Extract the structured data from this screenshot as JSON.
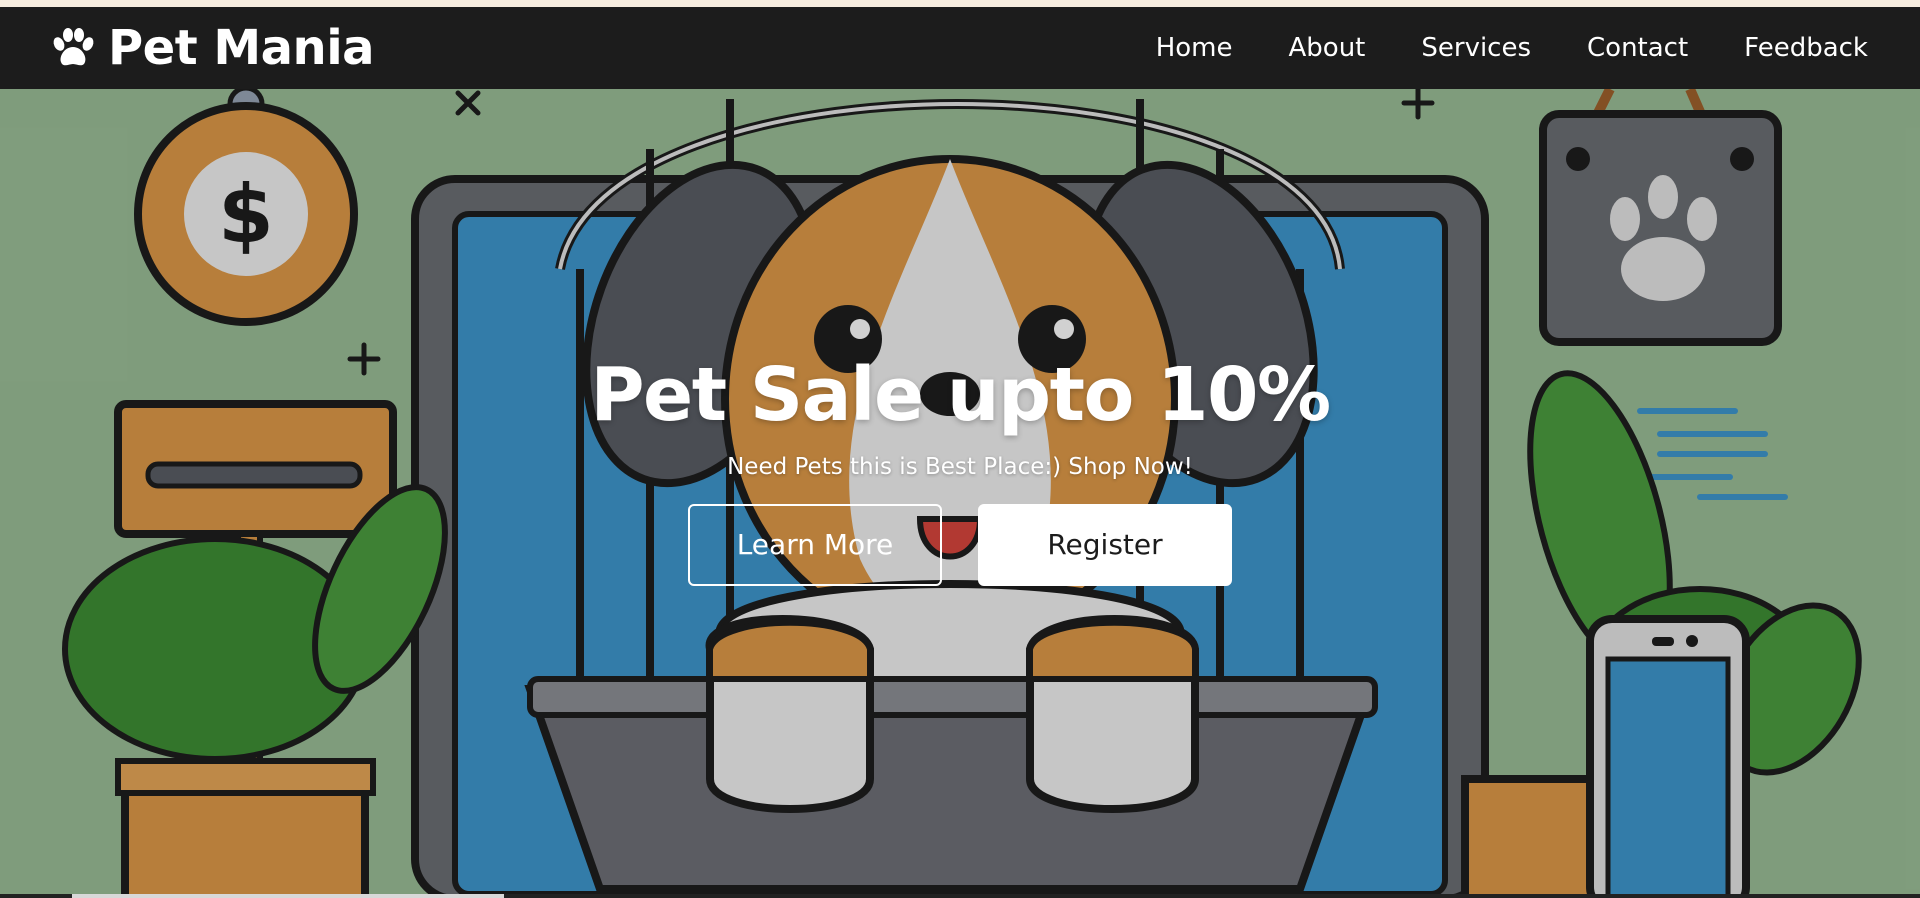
{
  "brand": {
    "name": "Pet Mania",
    "icon": "paw-icon"
  },
  "nav": {
    "items": [
      {
        "label": "Home"
      },
      {
        "label": "About"
      },
      {
        "label": "Services"
      },
      {
        "label": "Contact"
      },
      {
        "label": "Feedback"
      }
    ]
  },
  "hero": {
    "title": "Pet Sale upto 10%",
    "subtitle": "Need Pets this is Best Place:) Shop Now!",
    "primary_button": "Learn More",
    "secondary_button": "Register"
  },
  "colors": {
    "navbar": "#1c1c1c",
    "hero_background": "#9cbf98",
    "button_text": "#1c1c1c"
  }
}
